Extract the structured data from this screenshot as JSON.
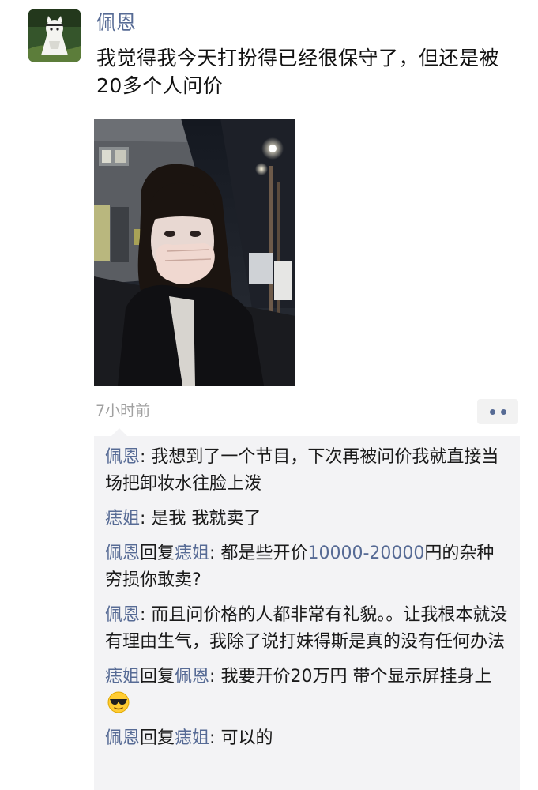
{
  "post": {
    "username": "佩恩",
    "text": "我觉得我今天打扮得已经很保守了，但还是被20多个人问价",
    "time": "7小时前"
  },
  "icons": {
    "avatar": "cartoon-cat-avatar",
    "more": "more-dots-icon",
    "emoji": "sunglasses-face-emoji"
  },
  "colors": {
    "name": "#576b95",
    "text": "#1a1a1a",
    "time": "#a0a0a0",
    "comment_bg": "#f3f3f5"
  },
  "comments": [
    {
      "author": "佩恩",
      "reply_word": "",
      "reply_to": "",
      "sep": ": ",
      "text": "我想到了一个节目，下次再被问价我就直接当场把卸妆水往脸上泼"
    },
    {
      "author": "痣姐",
      "reply_word": "",
      "reply_to": "",
      "sep": ": ",
      "text": "是我 我就卖了"
    },
    {
      "author": "佩恩",
      "reply_word": "回复",
      "reply_to": "痣姐",
      "sep": ": ",
      "text_before": "都是些开价",
      "price": "10000-20000",
      "text_after": "円的杂种穷损你敢卖?"
    },
    {
      "author": "佩恩",
      "reply_word": "",
      "reply_to": "",
      "sep": ": ",
      "text": "而且问价格的人都非常有礼貌。。让我根本就没有理由生气，我除了说打妹得斯是真的没有任何办法"
    },
    {
      "author": "痣姐",
      "reply_word": "回复",
      "reply_to": "佩恩",
      "sep": ": ",
      "text": "我要开价20万円 带个显示屏挂身上"
    },
    {
      "author": "佩恩",
      "reply_word": "回复",
      "reply_to": "痣姐",
      "sep": ": ",
      "text": "可以的"
    }
  ]
}
